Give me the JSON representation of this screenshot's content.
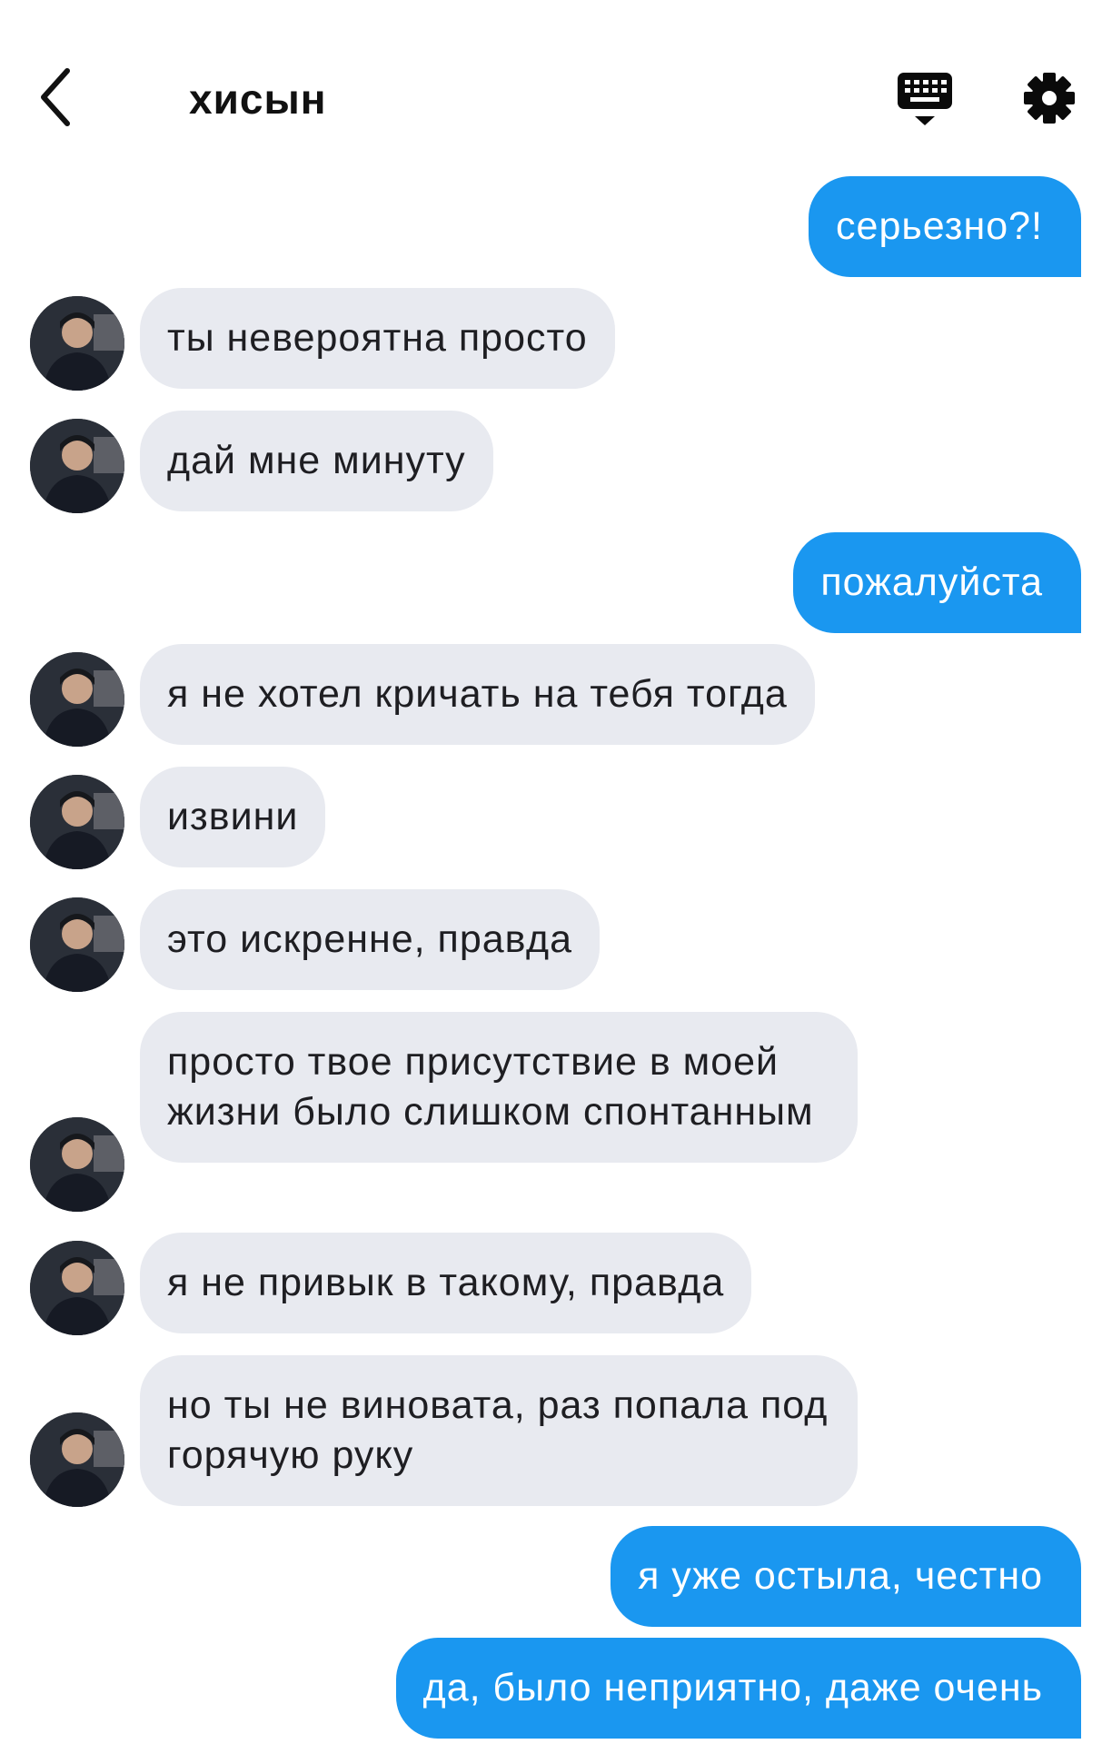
{
  "header": {
    "title": "хисын",
    "back_icon": "chevron-left-icon",
    "keyboard_icon": "keyboard-icon",
    "settings_icon": "gear-icon"
  },
  "colors": {
    "incoming_bubble": "#e8eaf0",
    "outgoing_bubble": "#1a97f0",
    "outgoing_text": "#ffffff"
  },
  "messages": [
    {
      "from": "me",
      "text": "серьезно?!"
    },
    {
      "from": "contact",
      "text": "ты невероятна просто"
    },
    {
      "from": "contact",
      "text": "дай мне минуту"
    },
    {
      "from": "me",
      "text": "пожалуйста"
    },
    {
      "from": "contact",
      "text": "я не хотел кричать на тебя тогда"
    },
    {
      "from": "contact",
      "text": "извини"
    },
    {
      "from": "contact",
      "text": "это искренне, правда"
    },
    {
      "from": "contact",
      "text": "просто твое присутствие в моей жизни было слишком спонтанным"
    },
    {
      "from": "contact",
      "text": "я не привык в такому, правда"
    },
    {
      "from": "contact",
      "text": "но ты не виновата, раз попала под горячую руку"
    },
    {
      "from": "me",
      "text": "я уже остыла, честно"
    },
    {
      "from": "me",
      "text": "да, было неприятно, даже очень"
    }
  ]
}
